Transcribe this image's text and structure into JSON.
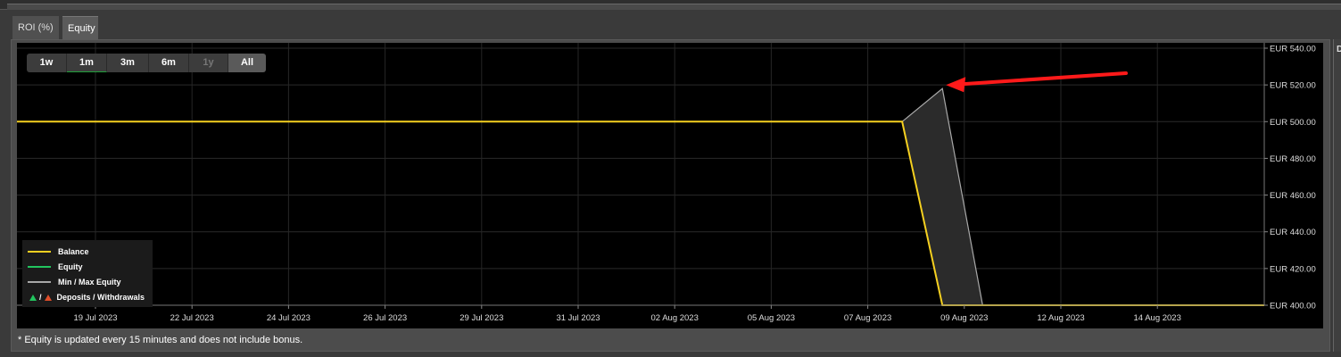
{
  "tabs": [
    {
      "label": "ROI (%)"
    },
    {
      "label": "Equity"
    }
  ],
  "range_buttons": [
    {
      "label": "1w"
    },
    {
      "label": "1m"
    },
    {
      "label": "3m"
    },
    {
      "label": "6m"
    },
    {
      "label": "1y"
    },
    {
      "label": "All"
    }
  ],
  "legend": {
    "balance": "Balance",
    "equity": "Equity",
    "minmax": "Min / Max Equity",
    "slash": "/",
    "deposits": "Deposits / Withdrawals"
  },
  "footnote": "* Equity is updated every 15 minutes and does not include bonus.",
  "right_card_letter": "D",
  "colors": {
    "balance": "#f5d020",
    "equity": "#22c55e",
    "minmax": "#a8a8a8",
    "deposit": "#22c55e",
    "withdrawal": "#e04e2a",
    "arrow": "#ff1a1a"
  },
  "chart_data": {
    "type": "line",
    "x_tick_labels": [
      "19 Jul 2023",
      "22 Jul 2023",
      "24 Jul 2023",
      "26 Jul 2023",
      "29 Jul 2023",
      "31 Jul 2023",
      "02 Aug 2023",
      "05 Aug 2023",
      "07 Aug 2023",
      "09 Aug 2023",
      "12 Aug 2023",
      "14 Aug 2023"
    ],
    "y_tick_labels": [
      "EUR 540.00",
      "EUR 520.00",
      "EUR 500.00",
      "EUR 480.00",
      "EUR 460.00",
      "EUR 440.00",
      "EUR 420.00",
      "EUR 400.00"
    ],
    "y_ticks": [
      540,
      520,
      500,
      480,
      460,
      440,
      420,
      400
    ],
    "ylim": [
      400,
      540
    ],
    "xlim": [
      "2023-07-17",
      "2023-08-17"
    ],
    "series": [
      {
        "name": "Balance",
        "x": [
          "2023-07-17",
          "2023-08-08",
          "2023-08-09",
          "2023-08-17"
        ],
        "values": [
          500,
          500,
          400,
          400
        ]
      },
      {
        "name": "Equity",
        "x": [],
        "values": []
      },
      {
        "name": "Min / Max Equity",
        "upper": {
          "x": [
            "2023-08-08",
            "2023-08-09",
            "2023-08-10"
          ],
          "values": [
            500,
            518,
            400
          ]
        },
        "lower": {
          "x": [
            "2023-08-08",
            "2023-08-09"
          ],
          "values": [
            500,
            400
          ]
        }
      }
    ],
    "legend_position": "bottom-left",
    "grid": true
  }
}
